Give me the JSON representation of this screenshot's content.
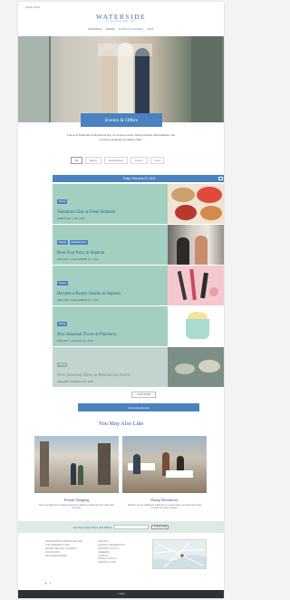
{
  "header": {
    "top_left": "SHOP NOW",
    "logo": "WATERSIDE",
    "logo_sub": "AT MARINA DEL REY",
    "nav": [
      "SHOPPING",
      "DINING",
      "EVENTS & OFFERS",
      "VISIT"
    ]
  },
  "hero": {
    "title": "Events & Offers"
  },
  "intro": "Join us at Waterside in Marina del Rey for in-store events, family-friendly entertainment, and exclusive shopping and dining offers.",
  "filters": [
    "All",
    "Beauty",
    "Entertainment",
    "Fitness",
    "Food"
  ],
  "events_header": {
    "label": "Today: February 22, 2022"
  },
  "events": [
    {
      "tags": [
        "Dining"
      ],
      "title": "Valentine's Day at Fresh Brothers",
      "date": "FEBRUARY 1-28, 2022"
    },
    {
      "tags": [
        "Beauty",
        "Entertainment"
      ],
      "title": "Host Your Party at Sephora",
      "date": "JANUARY 1-DECEMBER 31, 2022"
    },
    {
      "tags": [
        "Beauty"
      ],
      "title": "Become a Beauty Insider at Sephora",
      "date": "JANUARY 1-DECEMBER 31, 2022"
    },
    {
      "tags": [
        "Dining"
      ],
      "title": "New Seasonal Flavor at Pinkberry",
      "date": "JANUARY 1-MARCH 31, 2022"
    },
    {
      "tags": [
        "Dining"
      ],
      "title": "New Seasonal Menu at Mendocino Farms",
      "date": "JANUARY 1-MARCH 31, 2022"
    }
  ],
  "load_more": "LOAD MORE",
  "upcoming_button": "Upcoming Events",
  "you_may_also_like": "You May Also Like",
  "promos": [
    {
      "title": "Premier Shopping",
      "desc": "Shop everything from organic groceries to fashion to family-friendly retail, all in one place."
    },
    {
      "title": "Dining Destinations",
      "desc": "Whether you are looking for a light bite or a sweet treat, our restaurants have an option for every appetite."
    }
  ],
  "newsletter": {
    "label": "Get the Latest News and Offers",
    "placeholder": "",
    "button": "SUBSCRIBE"
  },
  "footer": {
    "col1": [
      "WATERSIDE AT MARINA DEL REY",
      "4700 ADMIRALTY WAY",
      "MARINA DEL REY, CA 90292",
      "310.306.8600",
      "INFO@WATERSIDE"
    ],
    "col2": [
      "TENANTS",
      "LEASING INFORMATION",
      "SECURITY POLICY",
      "CAREERS",
      "CONTACT",
      "PRIVACY POLICY",
      "TERMS OF USE"
    ],
    "social": [
      "f",
      "t"
    ],
    "copyright": "© 2022"
  },
  "colors": {
    "accent": "#4a82c0",
    "card_bg": "#a3cfc1",
    "newsletter_bg": "#dcebe6"
  }
}
